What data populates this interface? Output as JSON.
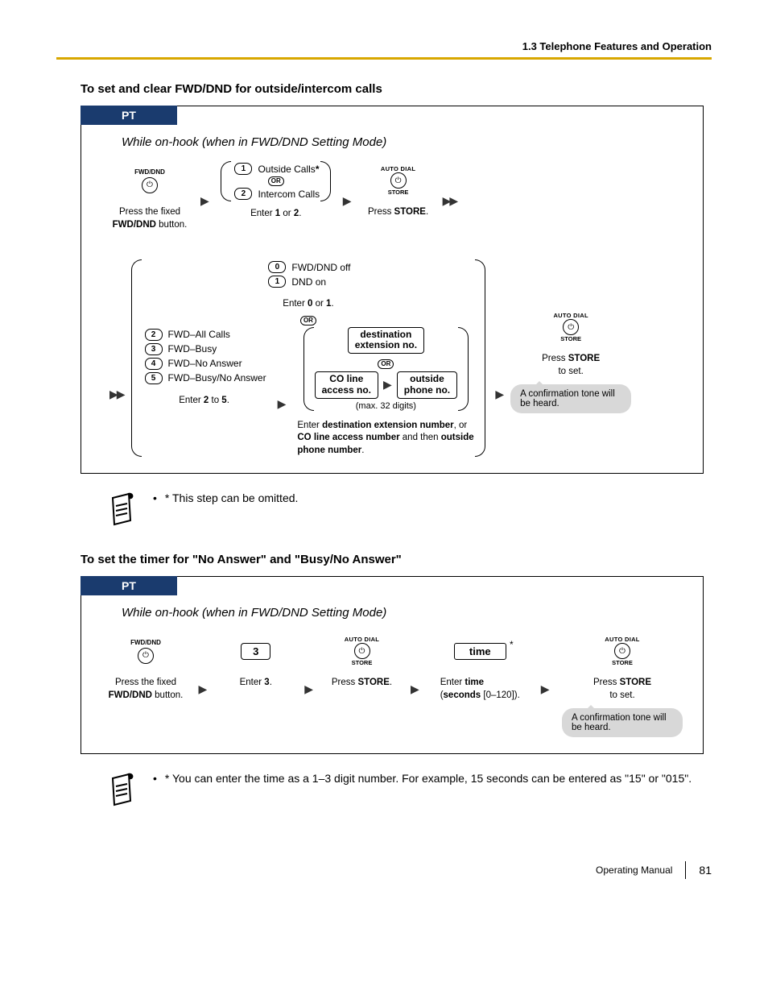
{
  "header": "1.3 Telephone Features and Operation",
  "section1": {
    "title": "To set and clear FWD/DND for outside/intercom calls",
    "pt": "PT",
    "mode": "While on-hook (when in FWD/DND Setting Mode)",
    "fwd_dnd": "FWD/DND",
    "row1": {
      "opt1_key": "1",
      "opt1_label": "Outside Calls",
      "opt1_star": "*",
      "or": "OR",
      "opt2_key": "2",
      "opt2_label": "Intercom Calls",
      "caption1": "Press the fixed ",
      "caption1b": "FWD/DND",
      "caption1c": " button.",
      "caption2a": "Enter ",
      "caption2b": "1",
      "caption2c": " or ",
      "caption2d": "2",
      "caption2e": ".",
      "auto_dial": "AUTO DIAL",
      "store": "STORE",
      "caption3a": "Press ",
      "caption3b": "STORE",
      "caption3c": "."
    },
    "row2": {
      "top_opt0_key": "0",
      "top_opt0_label": "FWD/DND off",
      "top_opt1_key": "1",
      "top_opt1_label": "DND on",
      "top_caption_a": "Enter ",
      "top_caption_b": "0",
      "top_caption_c": " or ",
      "top_caption_d": "1",
      "top_caption_e": ".",
      "or": "OR",
      "left_k2": "2",
      "left_l2": "FWD–All Calls",
      "left_k3": "3",
      "left_l3": "FWD–Busy",
      "left_k4": "4",
      "left_l4": "FWD–No Answer",
      "left_k5": "5",
      "left_l5": "FWD–Busy/No Answer",
      "left_caption_a": "Enter ",
      "left_caption_b": "2",
      "left_caption_c": " to ",
      "left_caption_d": "5",
      "left_caption_e": ".",
      "dest1a": "destination",
      "dest1b": "extension no.",
      "dest_or": "OR",
      "dest2a": "CO line",
      "dest2b": "access no.",
      "dest3a": "outside",
      "dest3b": "phone no.",
      "max": "(max. 32 digits)",
      "mid_cap_a": "Enter ",
      "mid_cap_b": "destination extension number",
      "mid_cap_c": ", or ",
      "mid_cap_d": "CO line access number",
      "mid_cap_e": " and then ",
      "mid_cap_f": "outside phone number",
      "mid_cap_g": ".",
      "auto_dial": "AUTO DIAL",
      "store": "STORE",
      "right_cap_a": "Press ",
      "right_cap_b": "STORE",
      "right_cap_c": " to set.",
      "conf": "A confirmation tone will be heard."
    },
    "note": "* This step can be omitted."
  },
  "section2": {
    "title": "To set the timer for \"No Answer\" and \"Busy/No Answer\"",
    "pt": "PT",
    "mode": "While on-hook (when in FWD/DND Setting Mode)",
    "fwd_dnd": "FWD/DND",
    "key3": "3",
    "auto_dial": "AUTO DIAL",
    "store": "STORE",
    "time": "time",
    "star": "*",
    "cap1a": "Press the fixed ",
    "cap1b": "FWD/DND",
    "cap1c": " button.",
    "cap2a": "Enter ",
    "cap2b": "3",
    "cap2c": ".",
    "cap3a": "Press ",
    "cap3b": "STORE",
    "cap3c": ".",
    "cap4a": "Enter ",
    "cap4b": "time",
    "cap4c": " (",
    "cap4d": "seconds",
    "cap4e": " [0–120]).",
    "cap5a": "Press ",
    "cap5b": "STORE",
    "cap5c": " to set.",
    "conf": "A confirmation tone will be heard.",
    "note": "* You can enter the time as a 1–3 digit number. For example, 15 seconds can be entered as \"15\" or \"015\"."
  },
  "footer": {
    "manual": "Operating Manual",
    "page": "81"
  }
}
